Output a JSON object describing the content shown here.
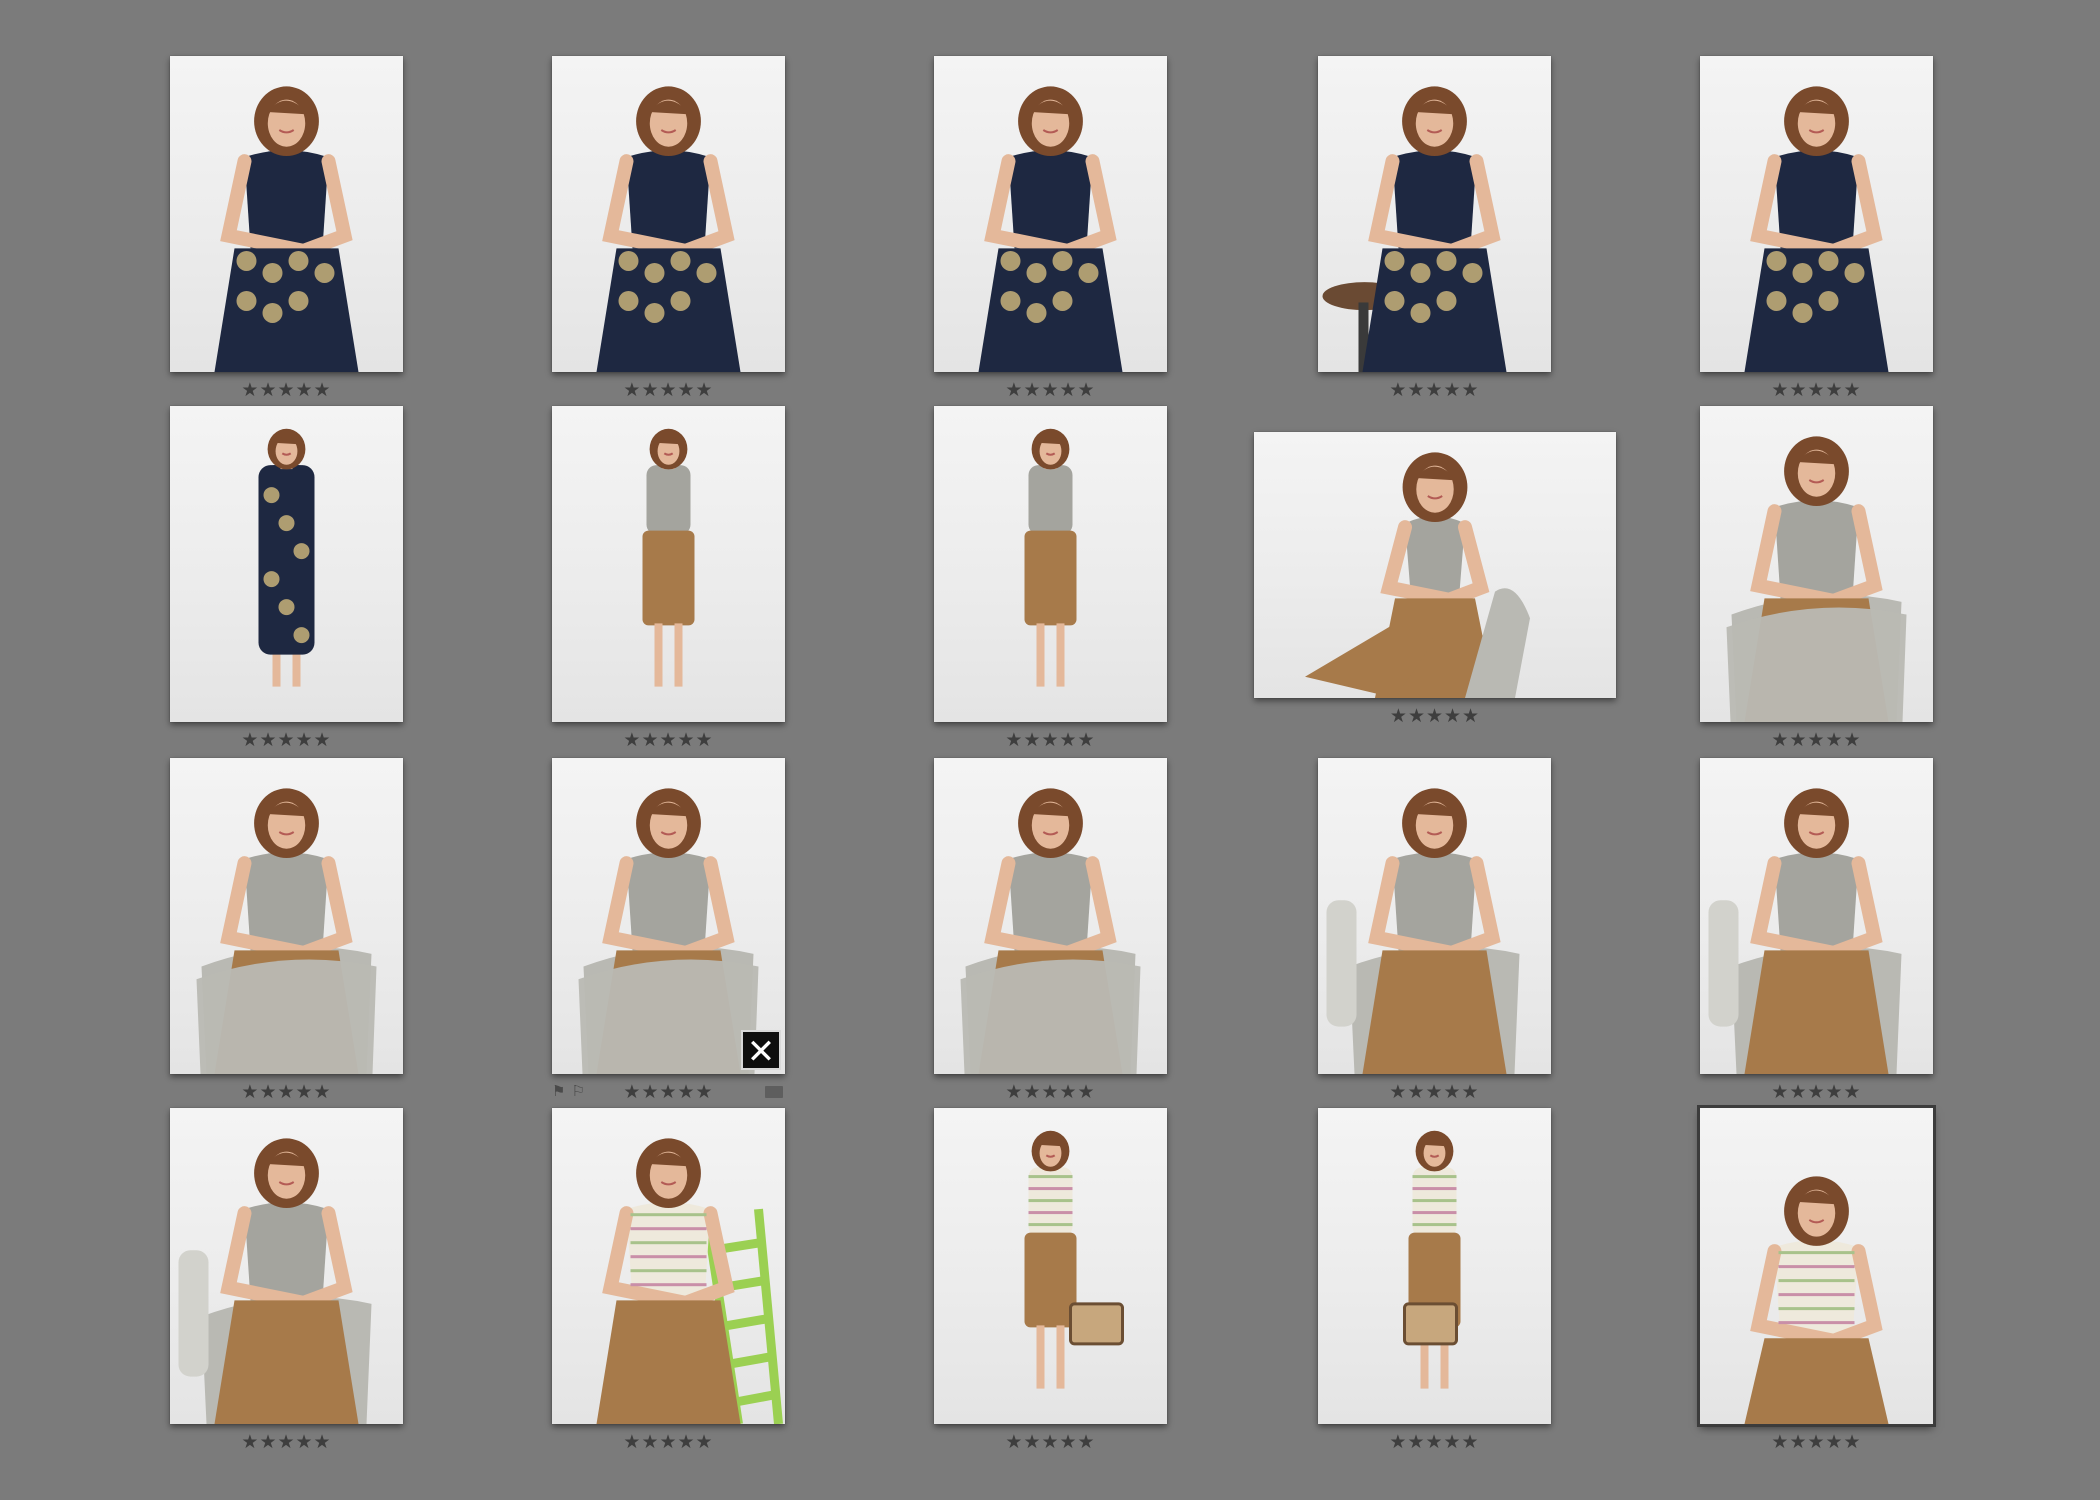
{
  "grid": {
    "columns": 5,
    "rows": 4,
    "cells": [
      {
        "id": 1,
        "orientation": "portrait",
        "outfit": "floral-navy-dress",
        "pose": "seated-lean",
        "rating": "★★★★★",
        "selected": false
      },
      {
        "id": 2,
        "orientation": "portrait",
        "outfit": "floral-navy-dress",
        "pose": "seated-chin",
        "rating": "★★★★★",
        "selected": false
      },
      {
        "id": 3,
        "orientation": "portrait",
        "outfit": "floral-navy-dress",
        "pose": "seated-tilt",
        "rating": "★★★★★",
        "selected": false
      },
      {
        "id": 4,
        "orientation": "portrait",
        "outfit": "floral-navy-dress",
        "pose": "stool-seated",
        "rating": "★★★★★",
        "selected": false
      },
      {
        "id": 5,
        "orientation": "portrait",
        "outfit": "floral-navy-dress",
        "pose": "arms-crossed",
        "rating": "★★★★★",
        "selected": false
      },
      {
        "id": 6,
        "orientation": "portrait",
        "outfit": "floral-navy-dress",
        "pose": "standing-hip",
        "rating": "★★★★★",
        "selected": false
      },
      {
        "id": 7,
        "orientation": "portrait",
        "outfit": "grey-top-tan-skirt",
        "pose": "standing-full",
        "rating": "★★★★★",
        "selected": false
      },
      {
        "id": 8,
        "orientation": "portrait",
        "outfit": "grey-top-tan-skirt",
        "pose": "standing-full",
        "rating": "★★★★★",
        "selected": false
      },
      {
        "id": 9,
        "orientation": "landscape",
        "outfit": "grey-top-tan-skirt",
        "pose": "chair-lounge",
        "rating": "★★★★★",
        "selected": false
      },
      {
        "id": 10,
        "orientation": "portrait",
        "outfit": "grey-top-tan-skirt",
        "pose": "chair-back",
        "rating": "★★★★★",
        "selected": false
      },
      {
        "id": 11,
        "orientation": "portrait",
        "outfit": "grey-top-tan-skirt",
        "pose": "chair-back",
        "rating": "★★★★★",
        "selected": false
      },
      {
        "id": 12,
        "orientation": "portrait",
        "outfit": "grey-top-tan-skirt",
        "pose": "chair-back",
        "rating": "★★★★★",
        "selected": false,
        "hover": true
      },
      {
        "id": 13,
        "orientation": "portrait",
        "outfit": "grey-top-tan-skirt",
        "pose": "chair-back",
        "rating": "★★★★★",
        "selected": false
      },
      {
        "id": 14,
        "orientation": "portrait",
        "outfit": "grey-top-tan-skirt",
        "pose": "chair-seated",
        "rating": "★★★★★",
        "selected": false
      },
      {
        "id": 15,
        "orientation": "portrait",
        "outfit": "grey-top-tan-skirt",
        "pose": "chair-laugh",
        "rating": "★★★★★",
        "selected": false
      },
      {
        "id": 16,
        "orientation": "portrait",
        "outfit": "grey-top-tan-skirt",
        "pose": "chair-seated",
        "rating": "★★★★★",
        "selected": false
      },
      {
        "id": 17,
        "orientation": "portrait",
        "outfit": "striped-sweater",
        "pose": "ladder-seated",
        "rating": "★★★★★",
        "selected": false
      },
      {
        "id": 18,
        "orientation": "portrait",
        "outfit": "striped-sweater",
        "pose": "kick-suitcase",
        "rating": "★★★★★",
        "selected": false
      },
      {
        "id": 19,
        "orientation": "portrait",
        "outfit": "striped-sweater",
        "pose": "standing-suitcase",
        "rating": "★★★★★",
        "selected": false
      },
      {
        "id": 20,
        "orientation": "portrait",
        "outfit": "striped-sweater",
        "pose": "floor-seated",
        "rating": "★★★★★",
        "selected": true
      }
    ]
  },
  "hover_controls": {
    "flag_pick_icon": "⚑",
    "flag_reject_icon": "⚐",
    "reject_button_label": "✕"
  },
  "colors": {
    "background": "#7b7b7b",
    "hair": "#7a4a2c",
    "skin": "#e4b89a",
    "navy": "#1e2841",
    "floral": "#c8b27a",
    "grey_top": "#a4a49e",
    "tan_skirt": "#a77a4a",
    "chair": "#b9b9b3",
    "stripe_base": "#eee9dc"
  }
}
